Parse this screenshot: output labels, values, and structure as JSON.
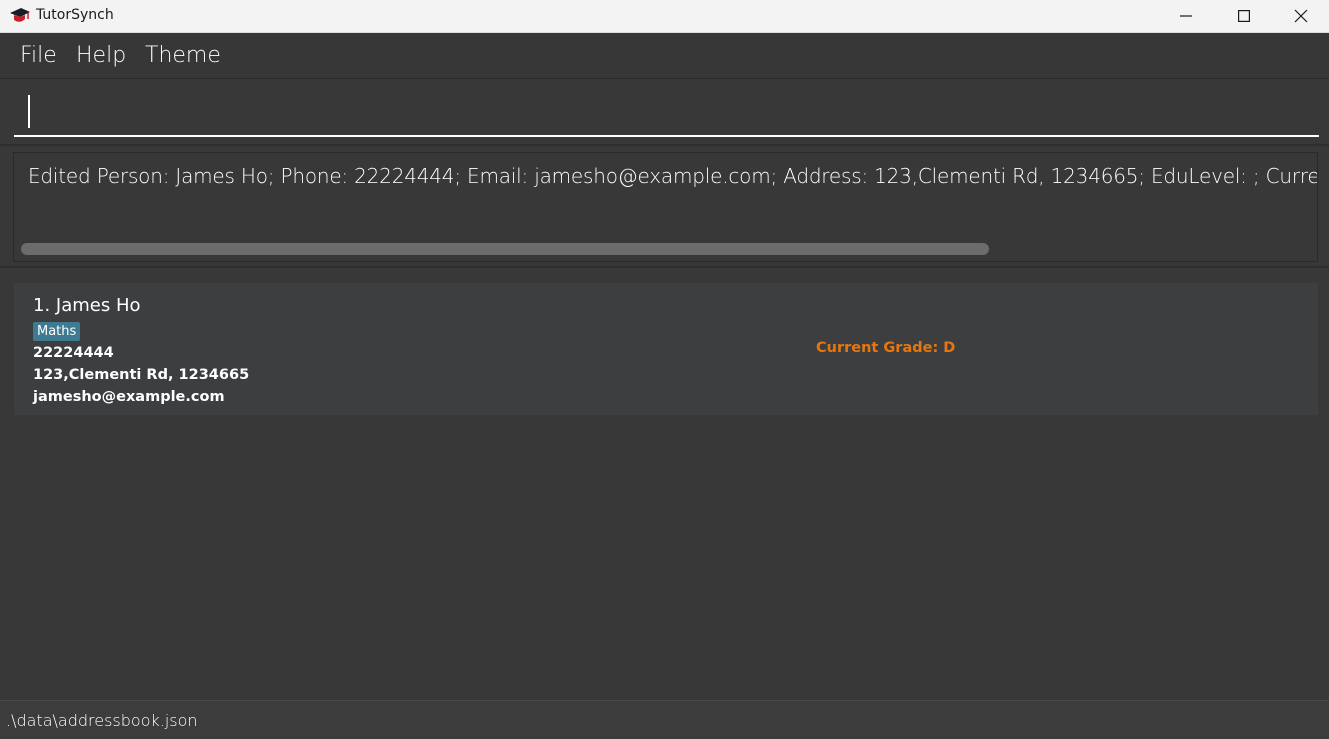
{
  "window": {
    "title": "TutorSynch",
    "controls": {
      "minimize": "minimize",
      "maximize": "maximize",
      "close": "close"
    }
  },
  "menu": {
    "items": [
      {
        "label": "File"
      },
      {
        "label": "Help"
      },
      {
        "label": "Theme"
      }
    ]
  },
  "command": {
    "value": "",
    "placeholder": ""
  },
  "result": {
    "text": "Edited Person: James Ho; Phone: 22224444; Email: jamesho@example.com; Address: 123,Clementi Rd, 1234665; EduLevel: ; Current Year: ; Current Grade: D; Tags: [Maths]"
  },
  "persons": [
    {
      "index_name": "1. James Ho",
      "tags": [
        "Maths"
      ],
      "phone": "22224444",
      "address": "123,Clementi Rd, 1234665",
      "email": "jamesho@example.com",
      "grade": "Current Grade: D"
    }
  ],
  "status": {
    "file_path": ".\\data\\addressbook.json"
  },
  "colors": {
    "background": "#383838",
    "card": "#3c3e40",
    "tag": "#3e7b91",
    "grade": "#e8760c",
    "titlebar": "#f3f3f3"
  }
}
